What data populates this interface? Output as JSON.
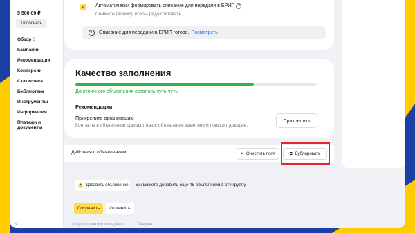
{
  "colors": {
    "accent_yellow": "#ffdb4d",
    "link_blue": "#2a6de8",
    "progress_green": "#2eb44a",
    "highlight_red": "#e3262e",
    "slide_bg": "#1c3fa6"
  },
  "sidebar": {
    "balance": "5 500,00 ₽",
    "pay_button": "Пополнить",
    "items": [
      {
        "label": "Обзор",
        "badge": "β"
      },
      {
        "label": "Кампании"
      },
      {
        "label": "Рекомендации"
      },
      {
        "label": "Конверсии"
      },
      {
        "label": "Статистика"
      },
      {
        "label": "Библиотека"
      },
      {
        "label": "Инструменты"
      },
      {
        "label": "Информация"
      },
      {
        "label": "Платежи и документы"
      }
    ],
    "collapse_icon": "chevron-left-icon"
  },
  "erip": {
    "checkbox_label": "Автоматически формировать описание для передачи в ЕРИП",
    "checkbox_hint": "Снимите галочку, чтобы редактировать",
    "notice_text": "Описание для передачи в ЕРИП готово.",
    "notice_link": "Посмотреть"
  },
  "quality": {
    "title": "Качество заполнения",
    "progress": 0.74,
    "progress_text": "До отличного объявления осталось чуть-чуть",
    "recommendations_heading": "Рекомендации",
    "rec_title": "Прикрепите организацию",
    "rec_desc": "Контакты в объявлении сделают ваше объявление заметнее и повысят доверие.",
    "rec_button": "Прикрепить"
  },
  "actions": {
    "label": "Действия с объявлением",
    "clear_button": "Очистить поля",
    "duplicate_button": "Дублировать"
  },
  "bottom": {
    "add_button": "Добавить объявление",
    "add_hint": "Вы можете добавить ещё 48 объявлений в эту группу",
    "save_button": "Сохранить",
    "cancel_button": "Отменить",
    "footer_links": [
      "Отдел клиентского сервиса",
      "Лендинг"
    ]
  }
}
